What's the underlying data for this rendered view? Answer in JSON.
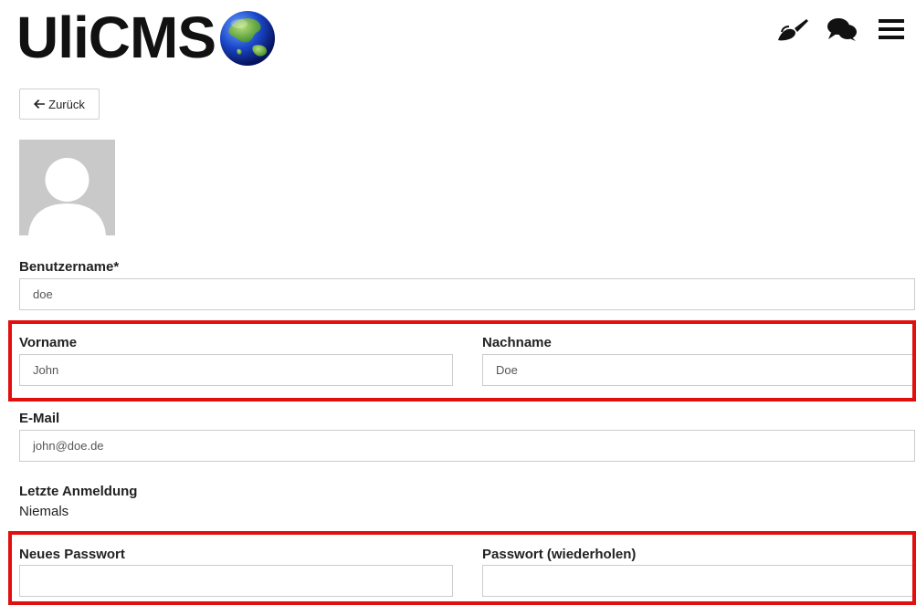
{
  "header": {
    "logo_text": "UliCMS",
    "icons": [
      "brush-icon",
      "comments-icon",
      "menu-icon"
    ]
  },
  "back_button": {
    "label": "Zurück",
    "icon": "arrow-left-icon"
  },
  "avatar": {
    "icon": "user-silhouette-icon"
  },
  "form": {
    "username": {
      "label": "Benutzername*",
      "value": "doe"
    },
    "firstname": {
      "label": "Vorname",
      "value": "John"
    },
    "lastname": {
      "label": "Nachname",
      "value": "Doe"
    },
    "email": {
      "label": "E-Mail",
      "value": "john@doe.de"
    },
    "last_login": {
      "label": "Letzte Anmeldung",
      "value": "Niemals"
    },
    "new_password": {
      "label": "Neues Passwort",
      "value": ""
    },
    "password_repeat": {
      "label": "Passwort (wiederholen)",
      "value": ""
    }
  },
  "colors": {
    "highlight": "#e20f0f",
    "input_border": "#cccccc",
    "avatar_bg": "#c9c9c9"
  }
}
